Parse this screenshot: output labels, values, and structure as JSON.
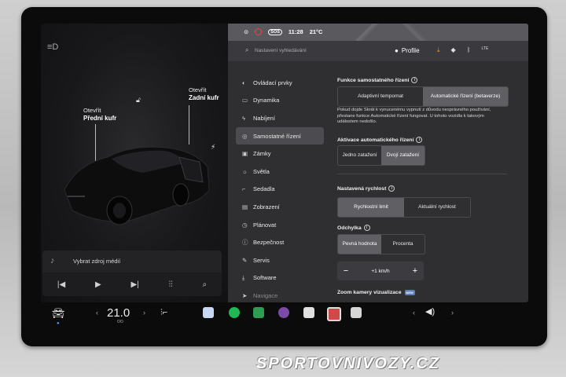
{
  "status": {
    "sos": "SOS",
    "time": "11:28",
    "temp": "21°C"
  },
  "search": {
    "placeholder": "Nastavení vyhledávání"
  },
  "profile": {
    "label": "Profile",
    "lte": "LTE"
  },
  "car": {
    "front_trunk_line1": "Otevřít",
    "front_trunk_line2": "Přední kufr",
    "rear_trunk_line1": "Otevřít",
    "rear_trunk_line2": "Zadní kufr"
  },
  "media": {
    "source_label": "Vybrat zdroj médií"
  },
  "nav": [
    {
      "label": "Ovládací prvky",
      "icon": "toggle-icon"
    },
    {
      "label": "Dynamika",
      "icon": "car-icon"
    },
    {
      "label": "Nabíjení",
      "icon": "bolt-icon"
    },
    {
      "label": "Samostatné řízení",
      "icon": "steering-icon"
    },
    {
      "label": "Zámky",
      "icon": "lock-icon"
    },
    {
      "label": "Světla",
      "icon": "sun-icon"
    },
    {
      "label": "Sedadla",
      "icon": "seat-icon"
    },
    {
      "label": "Zobrazení",
      "icon": "display-icon"
    },
    {
      "label": "Plánovat",
      "icon": "clock-icon"
    },
    {
      "label": "Bezpečnost",
      "icon": "info-icon"
    },
    {
      "label": "Servis",
      "icon": "wrench-icon"
    },
    {
      "label": "Software",
      "icon": "download-icon"
    },
    {
      "label": "Navigace",
      "icon": "navigation-icon"
    }
  ],
  "autopilot": {
    "title": "Funkce samostatného řízení",
    "opt1": "Adaptivní tempomat",
    "opt2": "Automatické řízení (betaverze)",
    "note": "Pokud dojde Skrát k vynucenému vypnutí z důvodu nesprávného používání, přestane funkce Automatické řízení fungovat. U tohoto vozidla k takovým událostem nedošlo.",
    "activation_title": "Aktivace automatického řízení",
    "act1": "Jedno zatažení",
    "act2": "Dvojí zatažení",
    "speed_title": "Nastavená rychlost",
    "speed1": "Rychlostní limit",
    "speed2": "Aktuální rychlost",
    "offset_title": "Odchylka",
    "off1": "Pevná hodnota",
    "off2": "Procenta",
    "offset_value": "+1 km/h",
    "minus": "−",
    "plus": "+",
    "zoom_title": "Zoom kamery vizualizace",
    "zoom_badge": "NEW"
  },
  "dock": {
    "temp": "21.0",
    "temp_decimal": ""
  },
  "watermark": "SPORTOVNIVOZY.CZ"
}
